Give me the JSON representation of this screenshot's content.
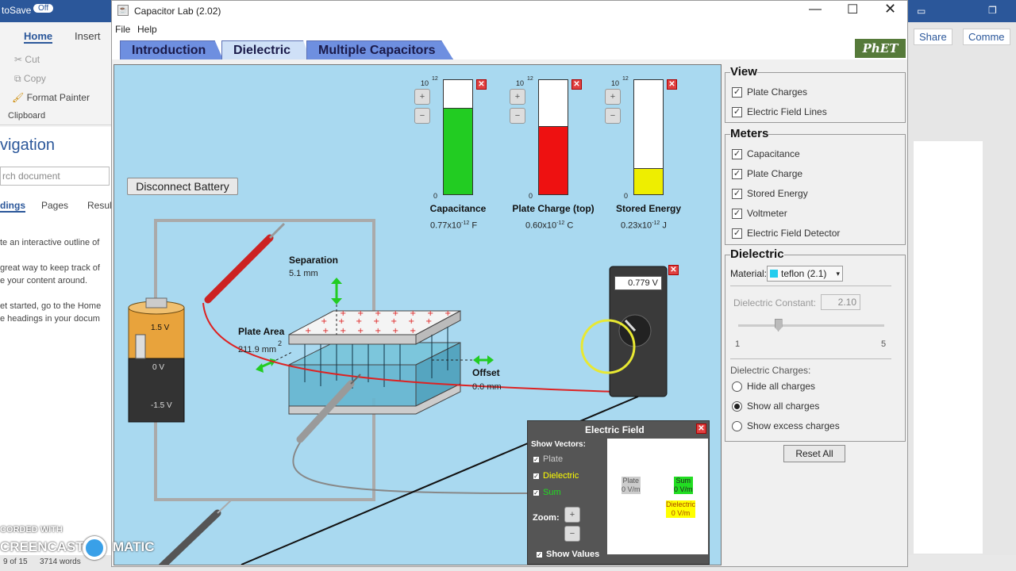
{
  "word": {
    "autosave_label": "toSave",
    "autosave_state": "Off",
    "tabs": [
      "Home",
      "Insert"
    ],
    "clipboard": [
      "Cut",
      "Copy",
      "Format Painter"
    ],
    "clipboard_group": "Clipboard",
    "nav_title": "vigation",
    "search_placeholder": "rch document",
    "nav_tabs": [
      "dings",
      "Pages",
      "Resul"
    ],
    "nav_text": [
      "te an interactive outline of",
      "great way to keep track of",
      "e your content around.",
      "et started, go to the Home",
      "e headings in your docum"
    ],
    "share": "Share",
    "comments": "Comme",
    "status_page": "9 of 15",
    "status_words": "3714 words",
    "watermark": "CORDED WITH",
    "watermark2": "CREENCAST",
    "watermark3": "MATIC"
  },
  "app": {
    "title": "Capacitor Lab (2.02)",
    "menu": [
      "File",
      "Help"
    ],
    "tabs": [
      "Introduction",
      "Dielectric",
      "Multiple Capacitors"
    ],
    "active_tab": "Dielectric",
    "logo": "PhET"
  },
  "play": {
    "disconnect_label": "Disconnect Battery",
    "battery": {
      "top": "1.5 V",
      "mid": "0 V",
      "bot": "-1.5 V"
    },
    "separation_label": "Separation",
    "separation_value": "5.1 mm",
    "plate_area_label": "Plate Area",
    "plate_area_value": "211.9 mm",
    "plate_area_exp": "2",
    "offset_label": "Offset",
    "offset_value": "0.0 mm",
    "voltmeter_value": "0.779 V",
    "meters": [
      {
        "label": "Capacitance",
        "value": "0.77x10",
        "exp": "-12",
        "unit": "F",
        "scale_top": "10",
        "scale_exp": "12",
        "zero": "0",
        "fill": 0.76,
        "color": "#22cc22"
      },
      {
        "label": "Plate Charge (top)",
        "value": "0.60x10",
        "exp": "-12",
        "unit": "C",
        "scale_top": "10",
        "scale_exp": "12",
        "zero": "0",
        "fill": 0.6,
        "color": "#ee1111"
      },
      {
        "label": "Stored Energy",
        "value": "0.23x10",
        "exp": "-12",
        "unit": "J",
        "scale_top": "10",
        "scale_exp": "12",
        "zero": "0",
        "fill": 0.23,
        "color": "#eeee00"
      }
    ],
    "electric_field": {
      "title": "Electric Field",
      "show_vectors": "Show Vectors:",
      "plate": "Plate",
      "dielectric": "Dielectric",
      "sum": "Sum",
      "zoom": "Zoom:",
      "show_values": "Show Values",
      "plate_val": "0 V/m",
      "sum_val": "0 V/m",
      "dielectric_val": "0 V/m",
      "plate_color": "#cccccc",
      "dielectric_color": "#ffff00",
      "sum_color": "#22dd22"
    }
  },
  "controls": {
    "view_title": "View",
    "view_items": [
      "Plate Charges",
      "Electric Field Lines"
    ],
    "meters_title": "Meters",
    "meters_items": [
      "Capacitance",
      "Plate Charge",
      "Stored Energy",
      "Voltmeter",
      "Electric Field Detector"
    ],
    "dielectric_title": "Dielectric",
    "material_label": "Material:",
    "material_value": "teflon (2.1)",
    "material_color": "#22ccee",
    "constant_label": "Dielectric Constant:",
    "constant_value": "2.10",
    "slider_min": "1",
    "slider_max": "5",
    "slider_value": 2.1,
    "charges_label": "Dielectric Charges:",
    "charges_options": [
      "Hide all charges",
      "Show all charges",
      "Show excess charges"
    ],
    "charges_selected": 1,
    "reset": "Reset All"
  }
}
